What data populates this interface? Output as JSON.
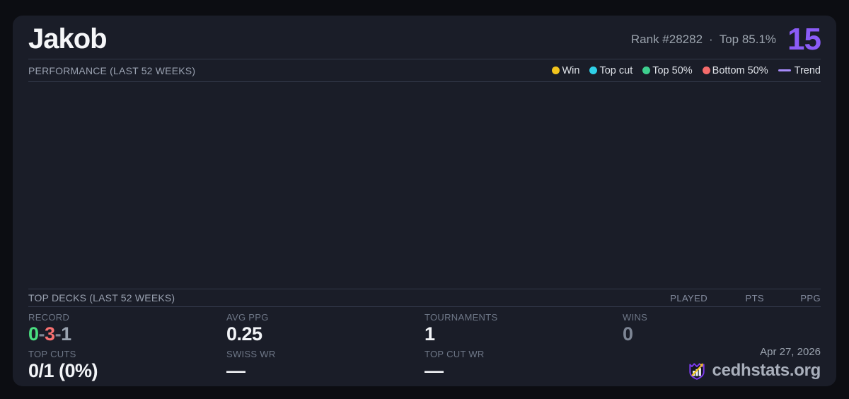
{
  "header": {
    "player_name": "Jakob",
    "rank_text": "Rank #28282",
    "separator": "·",
    "top_percent_text": "Top 85.1%",
    "score": "15",
    "accent_color": "#8b5cf6"
  },
  "performance": {
    "title": "PERFORMANCE (LAST 52 WEEKS)",
    "legend": [
      {
        "label": "Win",
        "type": "dot",
        "color": "#f2c41d"
      },
      {
        "label": "Top cut",
        "type": "dot",
        "color": "#2fd0e8"
      },
      {
        "label": "Top 50%",
        "type": "dot",
        "color": "#3ecf8e"
      },
      {
        "label": "Bottom 50%",
        "type": "dot",
        "color": "#f56b6b"
      },
      {
        "label": "Trend",
        "type": "line",
        "color": "#a78bfa"
      }
    ],
    "chart_points": []
  },
  "top_decks": {
    "title": "TOP DECKS (LAST 52 WEEKS)",
    "columns": [
      "PLAYED",
      "PTS",
      "PPG"
    ],
    "rows": []
  },
  "stats": {
    "record": {
      "label": "RECORD",
      "wins": "0",
      "losses": "3",
      "draws": "1",
      "separator": "-",
      "win_color": "#4ade80",
      "loss_color": "#f87171",
      "draw_color": "#9aa3b0"
    },
    "avg_ppg": {
      "label": "AVG PPG",
      "value": "0.25"
    },
    "tournaments": {
      "label": "TOURNAMENTS",
      "value": "1"
    },
    "wins": {
      "label": "WINS",
      "value": "0"
    },
    "top_cuts": {
      "label": "TOP CUTS",
      "value": "0/1 (0%)"
    },
    "swiss_wr": {
      "label": "SWISS WR",
      "value": "—"
    },
    "top_cut_wr": {
      "label": "TOP CUT WR",
      "value": "—"
    }
  },
  "footer": {
    "date": "Apr 27, 2026",
    "site": "cedhstats.org",
    "logo_shield_color": "#7c3aed",
    "logo_arrow_color": "#f2c41d"
  }
}
